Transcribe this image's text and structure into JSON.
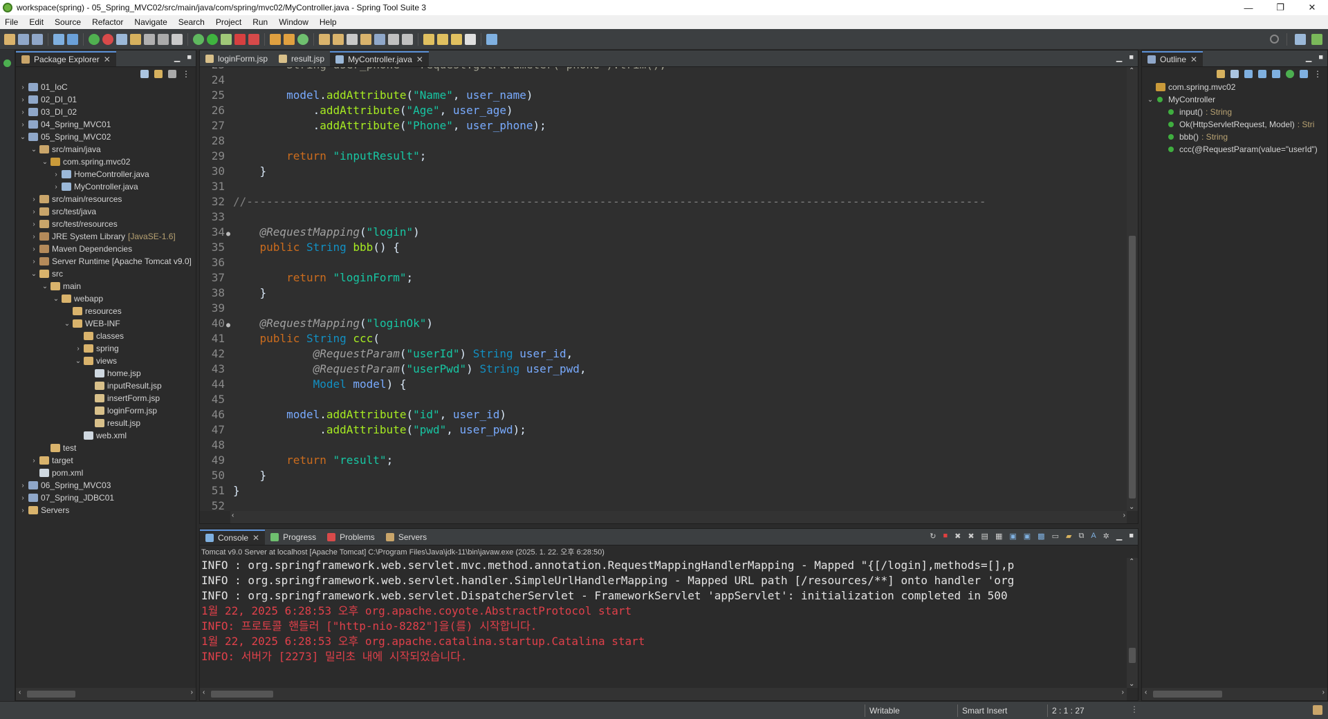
{
  "window": {
    "title": "workspace(spring) - 05_Spring_MVC02/src/main/java/com/spring/mvc02/MyController.java - Spring Tool Suite 3",
    "minimize": "—",
    "restore": "❐",
    "close": "✕"
  },
  "menu": [
    "File",
    "Edit",
    "Source",
    "Refactor",
    "Navigate",
    "Search",
    "Project",
    "Run",
    "Window",
    "Help"
  ],
  "package_explorer": {
    "title": "Package Explorer",
    "tree": [
      {
        "depth": 0,
        "tw": "›",
        "label": "01_IoC",
        "icon": "project",
        "deco": ""
      },
      {
        "depth": 0,
        "tw": "›",
        "label": "02_DI_01",
        "icon": "project",
        "deco": ""
      },
      {
        "depth": 0,
        "tw": "›",
        "label": "03_DI_02",
        "icon": "project",
        "deco": ""
      },
      {
        "depth": 0,
        "tw": "›",
        "label": "04_Spring_MVC01",
        "icon": "project",
        "deco": ""
      },
      {
        "depth": 0,
        "tw": "⌄",
        "label": "05_Spring_MVC02",
        "icon": "project",
        "deco": ""
      },
      {
        "depth": 1,
        "tw": "⌄",
        "label": "src/main/java",
        "icon": "srcfolder",
        "deco": ""
      },
      {
        "depth": 2,
        "tw": "⌄",
        "label": "com.spring.mvc02",
        "icon": "package",
        "deco": ""
      },
      {
        "depth": 3,
        "tw": "›",
        "label": "HomeController.java",
        "icon": "java",
        "deco": ""
      },
      {
        "depth": 3,
        "tw": "›",
        "label": "MyController.java",
        "icon": "java",
        "deco": ""
      },
      {
        "depth": 1,
        "tw": "›",
        "label": "src/main/resources",
        "icon": "srcfolder",
        "deco": ""
      },
      {
        "depth": 1,
        "tw": "›",
        "label": "src/test/java",
        "icon": "srcfolder",
        "deco": ""
      },
      {
        "depth": 1,
        "tw": "›",
        "label": "src/test/resources",
        "icon": "srcfolder",
        "deco": ""
      },
      {
        "depth": 1,
        "tw": "›",
        "label": "JRE System Library",
        "icon": "library",
        "deco": "[JavaSE-1.6]"
      },
      {
        "depth": 1,
        "tw": "›",
        "label": "Maven Dependencies",
        "icon": "library",
        "deco": ""
      },
      {
        "depth": 1,
        "tw": "›",
        "label": "Server Runtime [Apache Tomcat v9.0]",
        "icon": "library",
        "deco": ""
      },
      {
        "depth": 1,
        "tw": "⌄",
        "label": "src",
        "icon": "folder",
        "deco": ""
      },
      {
        "depth": 2,
        "tw": "⌄",
        "label": "main",
        "icon": "folder",
        "deco": ""
      },
      {
        "depth": 3,
        "tw": "⌄",
        "label": "webapp",
        "icon": "folder",
        "deco": ""
      },
      {
        "depth": 4,
        "tw": "",
        "label": "resources",
        "icon": "folder",
        "deco": ""
      },
      {
        "depth": 4,
        "tw": "⌄",
        "label": "WEB-INF",
        "icon": "folder",
        "deco": ""
      },
      {
        "depth": 5,
        "tw": "",
        "label": "classes",
        "icon": "folder",
        "deco": ""
      },
      {
        "depth": 5,
        "tw": "›",
        "label": "spring",
        "icon": "folder",
        "deco": ""
      },
      {
        "depth": 5,
        "tw": "⌄",
        "label": "views",
        "icon": "folder",
        "deco": ""
      },
      {
        "depth": 6,
        "tw": "",
        "label": "home.jsp",
        "icon": "file",
        "deco": ""
      },
      {
        "depth": 6,
        "tw": "",
        "label": "inputResult.jsp",
        "icon": "jsp",
        "deco": ""
      },
      {
        "depth": 6,
        "tw": "",
        "label": "insertForm.jsp",
        "icon": "jsp",
        "deco": ""
      },
      {
        "depth": 6,
        "tw": "",
        "label": "loginForm.jsp",
        "icon": "jsp",
        "deco": ""
      },
      {
        "depth": 6,
        "tw": "",
        "label": "result.jsp",
        "icon": "jsp",
        "deco": ""
      },
      {
        "depth": 5,
        "tw": "",
        "label": "web.xml",
        "icon": "xml",
        "deco": ""
      },
      {
        "depth": 2,
        "tw": "",
        "label": "test",
        "icon": "folder",
        "deco": ""
      },
      {
        "depth": 1,
        "tw": "›",
        "label": "target",
        "icon": "folder",
        "deco": ""
      },
      {
        "depth": 1,
        "tw": "",
        "label": "pom.xml",
        "icon": "xml",
        "deco": ""
      },
      {
        "depth": 0,
        "tw": "›",
        "label": "06_Spring_MVC03",
        "icon": "project",
        "deco": ""
      },
      {
        "depth": 0,
        "tw": "›",
        "label": "07_Spring_JDBC01",
        "icon": "project",
        "deco": ""
      },
      {
        "depth": 0,
        "tw": "›",
        "label": "Servers",
        "icon": "folder",
        "deco": ""
      }
    ]
  },
  "editor": {
    "tabs": [
      {
        "label": "loginForm.jsp",
        "active": false
      },
      {
        "label": "result.jsp",
        "active": false
      },
      {
        "label": "MyController.java",
        "active": true
      }
    ],
    "partial_top_line": {
      "ln": "23",
      "code": "        String user_phone = request.getParameter(\"phone\").trim();"
    },
    "lines": [
      {
        "ln": "24",
        "bp": "",
        "tokens": []
      },
      {
        "ln": "25",
        "bp": "",
        "tokens": [
          [
            "plain",
            "        "
          ],
          [
            "var",
            "model"
          ],
          [
            "plain",
            "."
          ],
          [
            "mth",
            "addAttribute"
          ],
          [
            "plain",
            "("
          ],
          [
            "str",
            "\"Name\""
          ],
          [
            "plain",
            ", "
          ],
          [
            "var",
            "user_name"
          ],
          [
            "plain",
            ")"
          ]
        ]
      },
      {
        "ln": "26",
        "bp": "",
        "tokens": [
          [
            "plain",
            "            ."
          ],
          [
            "mth",
            "addAttribute"
          ],
          [
            "plain",
            "("
          ],
          [
            "str",
            "\"Age\""
          ],
          [
            "plain",
            ", "
          ],
          [
            "var",
            "user_age"
          ],
          [
            "plain",
            ")"
          ]
        ]
      },
      {
        "ln": "27",
        "bp": "",
        "tokens": [
          [
            "plain",
            "            ."
          ],
          [
            "mth",
            "addAttribute"
          ],
          [
            "plain",
            "("
          ],
          [
            "str",
            "\"Phone\""
          ],
          [
            "plain",
            ", "
          ],
          [
            "var",
            "user_phone"
          ],
          [
            "plain",
            ");"
          ]
        ]
      },
      {
        "ln": "28",
        "bp": "",
        "tokens": []
      },
      {
        "ln": "29",
        "bp": "",
        "tokens": [
          [
            "plain",
            "        "
          ],
          [
            "kw",
            "return"
          ],
          [
            "plain",
            " "
          ],
          [
            "str",
            "\"inputResult\""
          ],
          [
            "plain",
            ";"
          ]
        ]
      },
      {
        "ln": "30",
        "bp": "",
        "tokens": [
          [
            "plain",
            "    }"
          ]
        ]
      },
      {
        "ln": "31",
        "bp": "",
        "tokens": []
      },
      {
        "ln": "32",
        "bp": "",
        "tokens": [
          [
            "cmt",
            "//---------------------------------------------------------------------------------------------------------------"
          ]
        ]
      },
      {
        "ln": "33",
        "bp": "",
        "tokens": []
      },
      {
        "ln": "34",
        "bp": "●",
        "tokens": [
          [
            "plain",
            "    "
          ],
          [
            "ann",
            "@RequestMapping"
          ],
          [
            "plain",
            "("
          ],
          [
            "str",
            "\"login\""
          ],
          [
            "plain",
            ")"
          ]
        ]
      },
      {
        "ln": "35",
        "bp": "",
        "tokens": [
          [
            "plain",
            "    "
          ],
          [
            "kw",
            "public"
          ],
          [
            "plain",
            " "
          ],
          [
            "type",
            "String"
          ],
          [
            "plain",
            " "
          ],
          [
            "mth",
            "bbb"
          ],
          [
            "plain",
            "() {"
          ]
        ]
      },
      {
        "ln": "36",
        "bp": "",
        "tokens": []
      },
      {
        "ln": "37",
        "bp": "",
        "tokens": [
          [
            "plain",
            "        "
          ],
          [
            "kw",
            "return"
          ],
          [
            "plain",
            " "
          ],
          [
            "str",
            "\"loginForm\""
          ],
          [
            "plain",
            ";"
          ]
        ]
      },
      {
        "ln": "38",
        "bp": "",
        "tokens": [
          [
            "plain",
            "    }"
          ]
        ]
      },
      {
        "ln": "39",
        "bp": "",
        "tokens": []
      },
      {
        "ln": "40",
        "bp": "●",
        "tokens": [
          [
            "plain",
            "    "
          ],
          [
            "ann",
            "@RequestMapping"
          ],
          [
            "plain",
            "("
          ],
          [
            "str",
            "\"loginOk\""
          ],
          [
            "plain",
            ")"
          ]
        ]
      },
      {
        "ln": "41",
        "bp": "",
        "tokens": [
          [
            "plain",
            "    "
          ],
          [
            "kw",
            "public"
          ],
          [
            "plain",
            " "
          ],
          [
            "type",
            "String"
          ],
          [
            "plain",
            " "
          ],
          [
            "mth",
            "ccc"
          ],
          [
            "plain",
            "("
          ]
        ]
      },
      {
        "ln": "42",
        "bp": "",
        "tokens": [
          [
            "plain",
            "            "
          ],
          [
            "ann",
            "@RequestParam"
          ],
          [
            "plain",
            "("
          ],
          [
            "str",
            "\"userId\""
          ],
          [
            "plain",
            ") "
          ],
          [
            "type",
            "String"
          ],
          [
            "plain",
            " "
          ],
          [
            "var",
            "user_id"
          ],
          [
            "plain",
            ","
          ]
        ]
      },
      {
        "ln": "43",
        "bp": "",
        "tokens": [
          [
            "plain",
            "            "
          ],
          [
            "ann",
            "@RequestParam"
          ],
          [
            "plain",
            "("
          ],
          [
            "str",
            "\"userPwd\""
          ],
          [
            "plain",
            ") "
          ],
          [
            "type",
            "String"
          ],
          [
            "plain",
            " "
          ],
          [
            "var",
            "user_pwd"
          ],
          [
            "plain",
            ","
          ]
        ]
      },
      {
        "ln": "44",
        "bp": "",
        "tokens": [
          [
            "plain",
            "            "
          ],
          [
            "type",
            "Model"
          ],
          [
            "plain",
            " "
          ],
          [
            "var",
            "model"
          ],
          [
            "plain",
            ") {"
          ]
        ]
      },
      {
        "ln": "45",
        "bp": "",
        "tokens": []
      },
      {
        "ln": "46",
        "bp": "",
        "tokens": [
          [
            "plain",
            "        "
          ],
          [
            "var",
            "model"
          ],
          [
            "plain",
            "."
          ],
          [
            "mth",
            "addAttribute"
          ],
          [
            "plain",
            "("
          ],
          [
            "str",
            "\"id\""
          ],
          [
            "plain",
            ", "
          ],
          [
            "var",
            "user_id"
          ],
          [
            "plain",
            ")"
          ]
        ]
      },
      {
        "ln": "47",
        "bp": "",
        "tokens": [
          [
            "plain",
            "             ."
          ],
          [
            "mth",
            "addAttribute"
          ],
          [
            "plain",
            "("
          ],
          [
            "str",
            "\"pwd\""
          ],
          [
            "plain",
            ", "
          ],
          [
            "var",
            "user_pwd"
          ],
          [
            "plain",
            ");"
          ]
        ]
      },
      {
        "ln": "48",
        "bp": "",
        "tokens": []
      },
      {
        "ln": "49",
        "bp": "",
        "tokens": [
          [
            "plain",
            "        "
          ],
          [
            "kw",
            "return"
          ],
          [
            "plain",
            " "
          ],
          [
            "str",
            "\"result\""
          ],
          [
            "plain",
            ";"
          ]
        ]
      },
      {
        "ln": "50",
        "bp": "",
        "tokens": [
          [
            "plain",
            "    }"
          ]
        ]
      },
      {
        "ln": "51",
        "bp": "",
        "tokens": [
          [
            "plain",
            "}"
          ]
        ]
      },
      {
        "ln": "52",
        "bp": "",
        "tokens": []
      }
    ]
  },
  "outline": {
    "title": "Outline",
    "items": [
      {
        "depth": 0,
        "tw": "",
        "label": "com.spring.mvc02",
        "suffix": "",
        "icon": "package"
      },
      {
        "depth": 0,
        "tw": "⌄",
        "label": "MyController",
        "suffix": "",
        "icon": "class"
      },
      {
        "depth": 1,
        "tw": "",
        "label": "input()",
        "suffix": " : String",
        "icon": "method"
      },
      {
        "depth": 1,
        "tw": "",
        "label": "Ok(HttpServletRequest, Model)",
        "suffix": " : Stri",
        "icon": "method"
      },
      {
        "depth": 1,
        "tw": "",
        "label": "bbb()",
        "suffix": " : String",
        "icon": "method"
      },
      {
        "depth": 1,
        "tw": "",
        "label": "ccc(@RequestParam(value=\"userId\")",
        "suffix": "",
        "icon": "method"
      }
    ]
  },
  "console": {
    "tabs": [
      {
        "label": "Console",
        "active": true,
        "icon": "console"
      },
      {
        "label": "Progress",
        "active": false,
        "icon": "progress"
      },
      {
        "label": "Problems",
        "active": false,
        "icon": "problems"
      },
      {
        "label": "Servers",
        "active": false,
        "icon": "servers"
      }
    ],
    "info": "Tomcat v9.0 Server at localhost [Apache Tomcat] C:\\Program Files\\Java\\jdk-11\\bin\\javaw.exe  (2025. 1. 22. 오후 6:28:50)",
    "lines": [
      {
        "kind": "info",
        "text": "INFO : org.springframework.web.servlet.mvc.method.annotation.RequestMappingHandlerMapping - Mapped \"{[/login],methods=[],p"
      },
      {
        "kind": "info",
        "text": "INFO : org.springframework.web.servlet.handler.SimpleUrlHandlerMapping - Mapped URL path [/resources/**] onto handler 'org"
      },
      {
        "kind": "info",
        "text": "INFO : org.springframework.web.servlet.DispatcherServlet - FrameworkServlet 'appServlet': initialization completed in 500"
      },
      {
        "kind": "err",
        "text": "1월 22, 2025 6:28:53 오후 org.apache.coyote.AbstractProtocol start"
      },
      {
        "kind": "err",
        "text": "INFO: 프로토콜 핸들러 [\"http-nio-8282\"]을(를) 시작합니다."
      },
      {
        "kind": "err",
        "text": "1월 22, 2025 6:28:53 오후 org.apache.catalina.startup.Catalina start"
      },
      {
        "kind": "err",
        "text": "INFO: 서버가 [2273] 밀리초 내에 시작되었습니다."
      }
    ]
  },
  "status": {
    "writable": "Writable",
    "insert_mode": "Smart Insert",
    "position": "2 : 1 : 27"
  },
  "colors": {
    "keyword": "#cc6c1d",
    "string": "#17c6a3",
    "variable": "#79abff",
    "method": "#a7ec21",
    "console_error": "#e0404a",
    "tab_accent": "#5a8fd6"
  }
}
